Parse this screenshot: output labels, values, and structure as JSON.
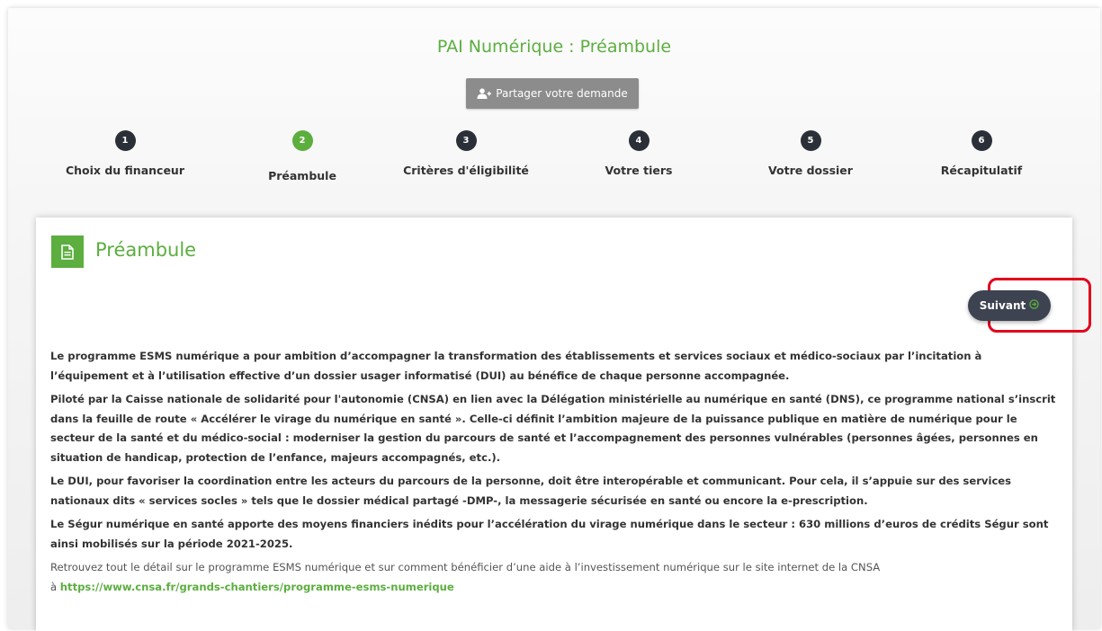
{
  "page": {
    "title": "PAI Numérique : Préambule"
  },
  "share": {
    "label": "Partager votre demande",
    "icon": "user-plus-icon"
  },
  "steps": [
    {
      "num": "1",
      "label": "Choix du financeur"
    },
    {
      "num": "2",
      "label": "Préambule",
      "active": true
    },
    {
      "num": "3",
      "label": "Critères d'éligibilité"
    },
    {
      "num": "4",
      "label": "Votre tiers"
    },
    {
      "num": "5",
      "label": "Votre dossier"
    },
    {
      "num": "6",
      "label": "Récapitulatif"
    }
  ],
  "card": {
    "title": "Préambule",
    "icon": "document-icon",
    "next_label": "Suivant",
    "next_icon": "arrow-circle-right-icon",
    "paragraphs": [
      "Le programme ESMS numérique a pour ambition d’accompagner la transformation des établissements et services sociaux et médico-sociaux par l’incitation à l’équipement et à l’utilisation effective d’un dossier usager informatisé (DUI) au bénéfice de chaque personne accompagnée.",
      "Piloté par la Caisse nationale de solidarité pour l'autonomie (CNSA) en lien avec la Délégation ministérielle au numérique en santé (DNS), ce programme national s’inscrit dans la feuille de route « Accélérer le virage du numérique en santé ». Celle-ci définit l’ambition majeure de la puissance publique en matière de numérique pour le secteur de la santé et du médico-social : moderniser la gestion du parcours de santé et l’accompagnement des personnes vulnérables (personnes âgées, personnes en situation de handicap, protection de l’enfance, majeurs accompagnés, etc.).",
      "Le DUI, pour favoriser la coordination entre les acteurs du parcours de la personne, doit être interopérable et communicant. Pour cela, il s’appuie sur des services nationaux dits « services socles » tels que le dossier médical partagé -DMP-, la messagerie sécurisée en santé ou encore la e-prescription.",
      "Le Ségur numérique en santé apporte des moyens financiers inédits pour l’accélération du virage numérique dans le secteur : 630 millions d’euros de crédits Ségur sont ainsi mobilisés sur la période 2021-2025."
    ],
    "footer_text": "Retrouvez tout le détail sur le programme ESMS numérique et sur comment bénéficier d’une aide à l’investissement numérique sur le site internet de la CNSA",
    "footer_prefix": "à",
    "footer_link": "https://www.cnsa.fr/grands-chantiers/programme-esms-numerique"
  },
  "colors": {
    "accent": "#5cae3f",
    "dark": "#2b2f37",
    "highlight": "#e2001a"
  }
}
